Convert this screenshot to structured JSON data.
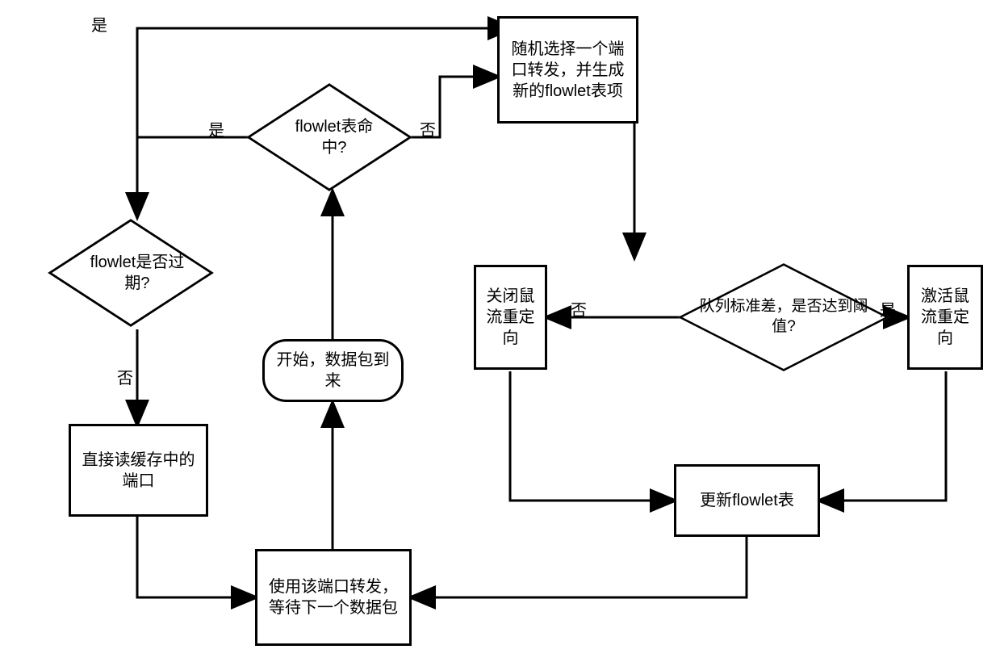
{
  "nodes": {
    "start": "开始，数据包到来",
    "flowlet_hit": "flowlet表命\n中?",
    "flowlet_expired": "flowlet是否过\n期?",
    "random_port": "随机选择一个端口转发，并生成新的flowlet表项",
    "read_cache": "直接读缓存中的端口",
    "use_port": "使用该端口转发，等待下一个数据包",
    "queue_std": "队列标准差，是否达到阈值?",
    "close_redirect": "关闭鼠流重定向",
    "activate_redirect": "激活鼠流重定向",
    "update_table": "更新flowlet表"
  },
  "labels": {
    "yes": "是",
    "no": "否"
  }
}
